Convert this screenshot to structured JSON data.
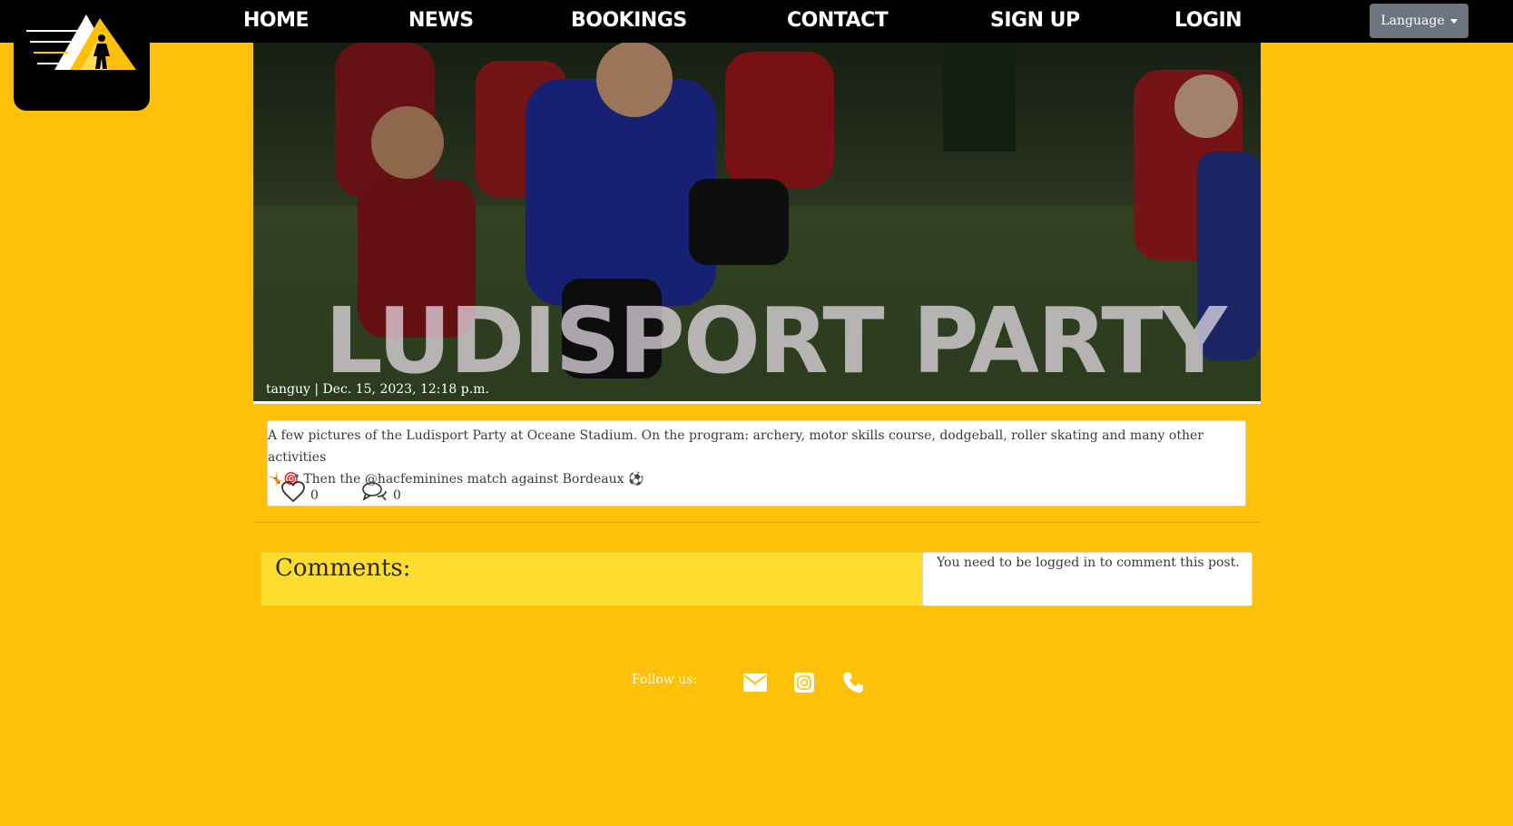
{
  "nav": {
    "items": [
      {
        "label": "HOME"
      },
      {
        "label": "NEWS"
      },
      {
        "label": "BOOKINGS"
      },
      {
        "label": "CONTACT"
      },
      {
        "label": "SIGN UP"
      },
      {
        "label": "LOGIN"
      }
    ],
    "language_label": "Language"
  },
  "post": {
    "title": "LUDISPORT PARTY",
    "meta": "tanguy | Dec. 15, 2023, 12:18 p.m.",
    "body_line1": "A few pictures of the Ludisport Party at Oceane Stadium. On the program: archery, motor skills course, dodgeball, roller skating and many other activities",
    "body_line2_emoji": "🤸🎯",
    "body_line2": "Then the @hacfeminines match against Bordeaux",
    "body_line2_end_emoji": "⚽",
    "likes": "0",
    "comments_count": "0"
  },
  "comments": {
    "heading": "Comments:",
    "login_notice": "You need to be logged in to comment this post."
  },
  "footer": {
    "follow_label": "Follow us:",
    "icons": [
      "envelope-icon",
      "instagram-icon",
      "phone-icon"
    ]
  },
  "colors": {
    "page_bg": "#FFC107",
    "nav_bg": "#000000",
    "comments_bg": "#FFDD2D",
    "language_btn": "#6C757D"
  }
}
